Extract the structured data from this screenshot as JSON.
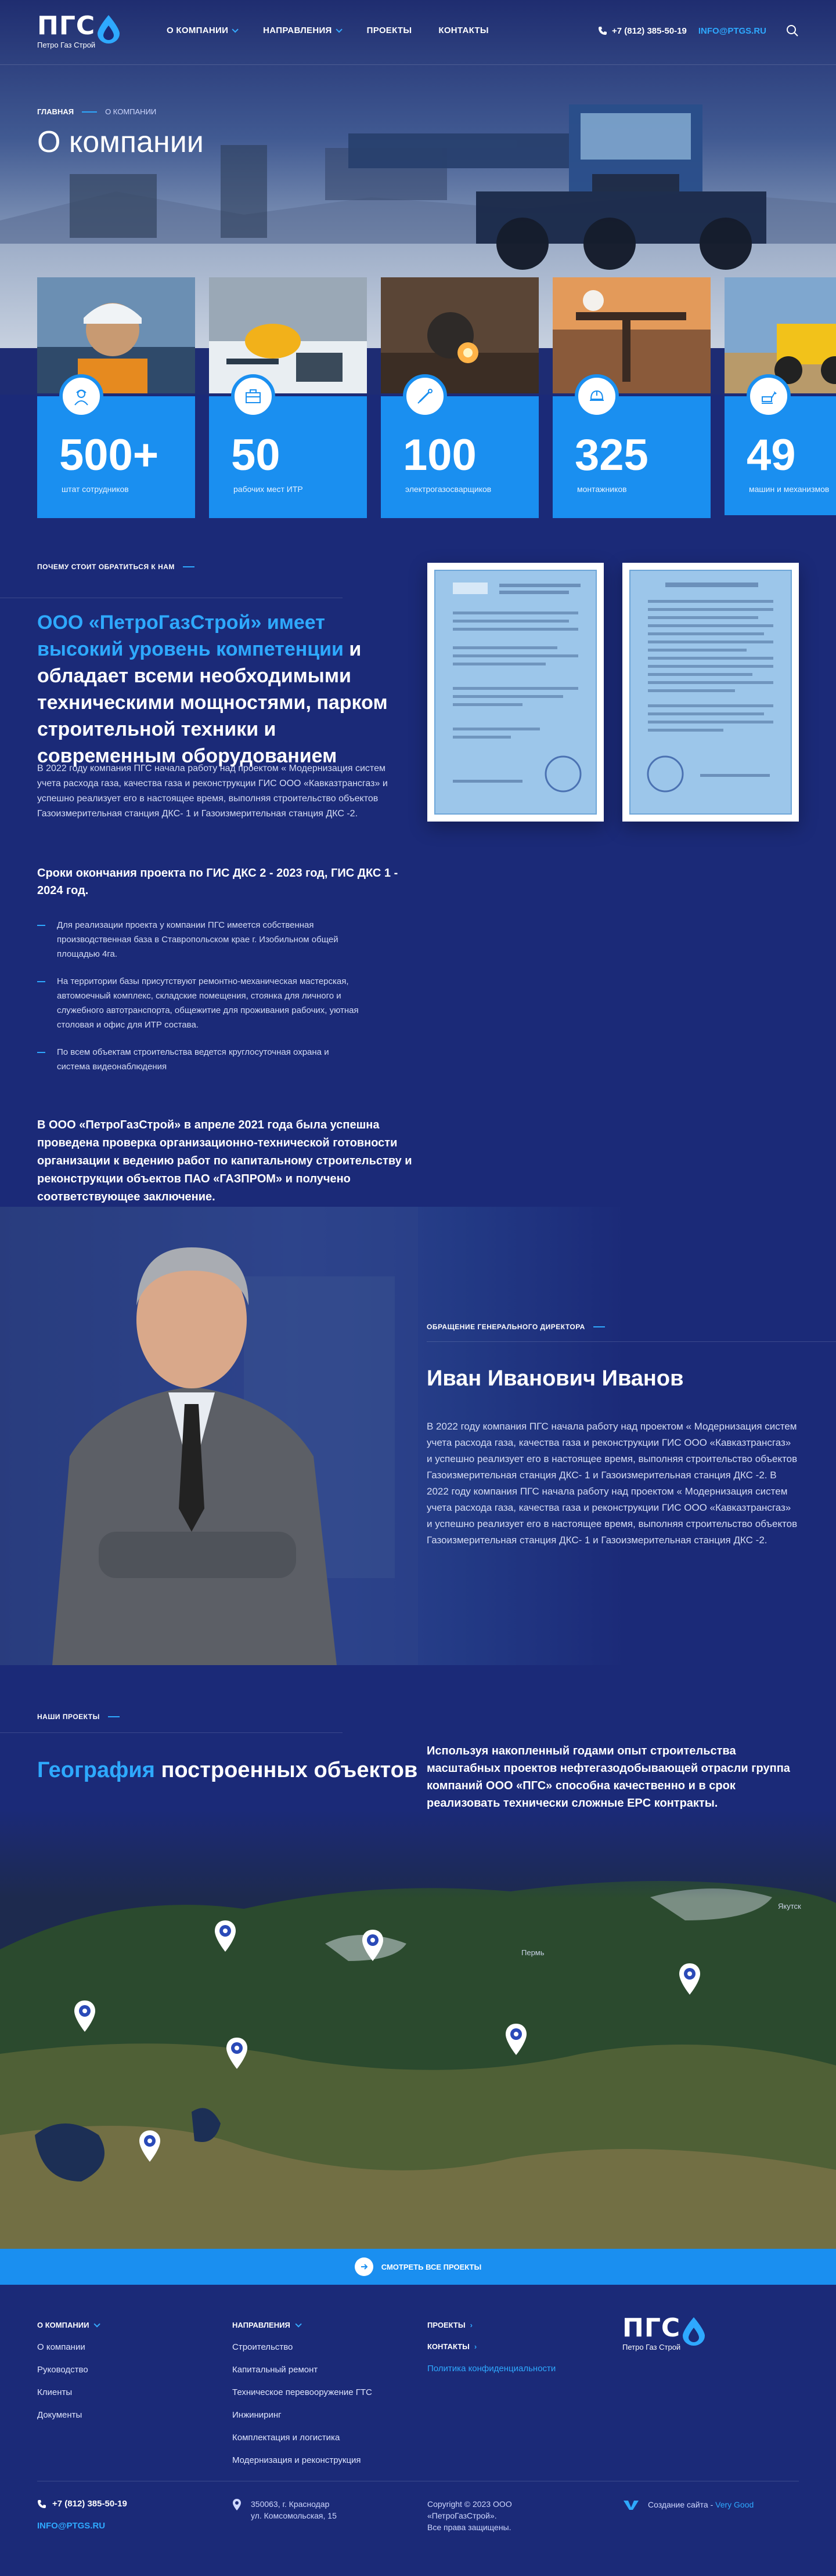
{
  "brand": {
    "logo": "ПГС",
    "sub": "Петро Газ Строй",
    "accent": "#2ea9ff",
    "bg": "#1b2a78",
    "card": "#1a8ff0"
  },
  "nav": {
    "items": [
      {
        "label": "О компании",
        "has_dropdown": true
      },
      {
        "label": "Направления",
        "has_dropdown": true
      },
      {
        "label": "Проекты",
        "has_dropdown": false
      },
      {
        "label": "Контакты",
        "has_dropdown": false
      }
    ]
  },
  "header": {
    "phone": "+7 (812) 385-50-19",
    "email": "INFO@PTGS.RU",
    "icons": [
      "phone-icon",
      "search-icon"
    ]
  },
  "breadcrumb": {
    "home": "Главная",
    "current": "О компании"
  },
  "page_title": "О компании",
  "stats": [
    {
      "value": "500+",
      "label": "штат сотрудников",
      "icon": "worker-icon"
    },
    {
      "value": "50",
      "label": "рабочих мест ИТР",
      "icon": "briefcase-icon"
    },
    {
      "value": "100",
      "label": "электрогазосварщиков",
      "icon": "welding-icon"
    },
    {
      "value": "325",
      "label": "монтажников",
      "icon": "helmet-icon"
    },
    {
      "value": "49",
      "label": "машин и механизмов",
      "icon": "excavator-icon"
    }
  ],
  "why": {
    "label": "Почему стоит обратиться к нам",
    "title_hl": "ООО «ПетроГазСтрой» имеет высокий уровень компетенции",
    "title_rest": " и обладает всеми необходимыми техническими мощностями, парком строительной техники и современным оборудованием",
    "paragraph": "В 2022 году компания ПГС начала работу над проектом « Модернизация систем учета расхода газа, качества газа и реконструкции ГИС ООО «Кавказтрансгаз» и успешно реализует его в настоящее время, выполняя строительство объектов Газоизмерительная станция ДКС- 1 и Газоизмерительная станция ДКС -2.",
    "deadline": "Сроки окончания проекта по ГИС ДКС 2 - 2023 год, ГИС ДКС 1 - 2024 год.",
    "list": [
      "Для реализации проекта у компании ПГС имеется собственная производственная база в Ставропольском крае г. Изобильном общей площадью 4га.",
      "На территории базы присутствуют ремонтно-механическая мастерская, автомоечный комплекс, складские помещения, стоянка для личного и служебного автотранспорта, общежитие для проживания рабочих, уютная столовая и офис для ИТР состава.",
      "По всем объектам строительства ведется круглосуточная охрана и система видеонаблюдения"
    ],
    "bold": "В ООО «ПетроГазСтрой» в апреле 2021 года была успешна проведена проверка организационно-технической  готовности организации к ведению работ по капитальному строительству и реконструкции объектов  ПАО «ГАЗПРОМ» и получено соответствующее заключение."
  },
  "director": {
    "label": "Обращение генерального директора",
    "name": "Иван Иванович Иванов",
    "text": "В 2022 году компания ПГС начала работу над проектом « Модернизация систем учета расхода газа, качества газа и реконструкции ГИС ООО «Кавказтрансгаз» и успешно реализует его в настоящее время, выполняя строительство объектов Газоизмерительная станция ДКС- 1 и Газоизмерительная станция ДКС -2.  В 2022 году компания ПГС начала работу над проектом « Модернизация систем учета расхода газа, качества газа и реконструкции ГИС ООО «Кавказтрансгаз» и успешно реализует его в настоящее время, выполняя строительство объектов Газоизмерительная станция ДКС- 1 и Газоизмерительная станция ДКС -2."
  },
  "projects": {
    "label": "Наши проекты",
    "title_hl": "География",
    "title_rest": " построенных объектов",
    "text": "Используя накопленный годами опыт строительства масштабных проектов нефтегазодобывающей отрасли группа компаний ООО «ПГС» способна качественно и в срок реализовать технически сложные EPC контракты.",
    "map_labels": [
      "Якутск",
      "Пермь"
    ],
    "button": "Смотреть все проекты"
  },
  "footer": {
    "col1_head": "О компании",
    "col1": [
      "О компании",
      "Руководство",
      "Клиенты",
      "Документы"
    ],
    "col2_head": "Направления",
    "col2": [
      "Строительство",
      "Капитальный ремонт",
      "Техническое перевооружение ГТС",
      "Инжиниринг",
      "Комплектация и логистика",
      "Модернизация и реконструкция"
    ],
    "col3_projects": "Проекты",
    "col3_contacts": "Контакты",
    "privacy": "Политика конфиденциальности",
    "phone": "+7 (812) 385-50-19",
    "email": "INFO@PTGS.RU",
    "address_1": "350063, г. Краснодар",
    "address_2": "ул. Комсомольская, 15",
    "copyright_1": "Copyright © 2023 ООО",
    "copyright_2": "«ПетроГазСтрой».",
    "copyright_3": "Все права защищены.",
    "dev_label": "Создание сайта - ",
    "dev_name": "Very Good"
  }
}
